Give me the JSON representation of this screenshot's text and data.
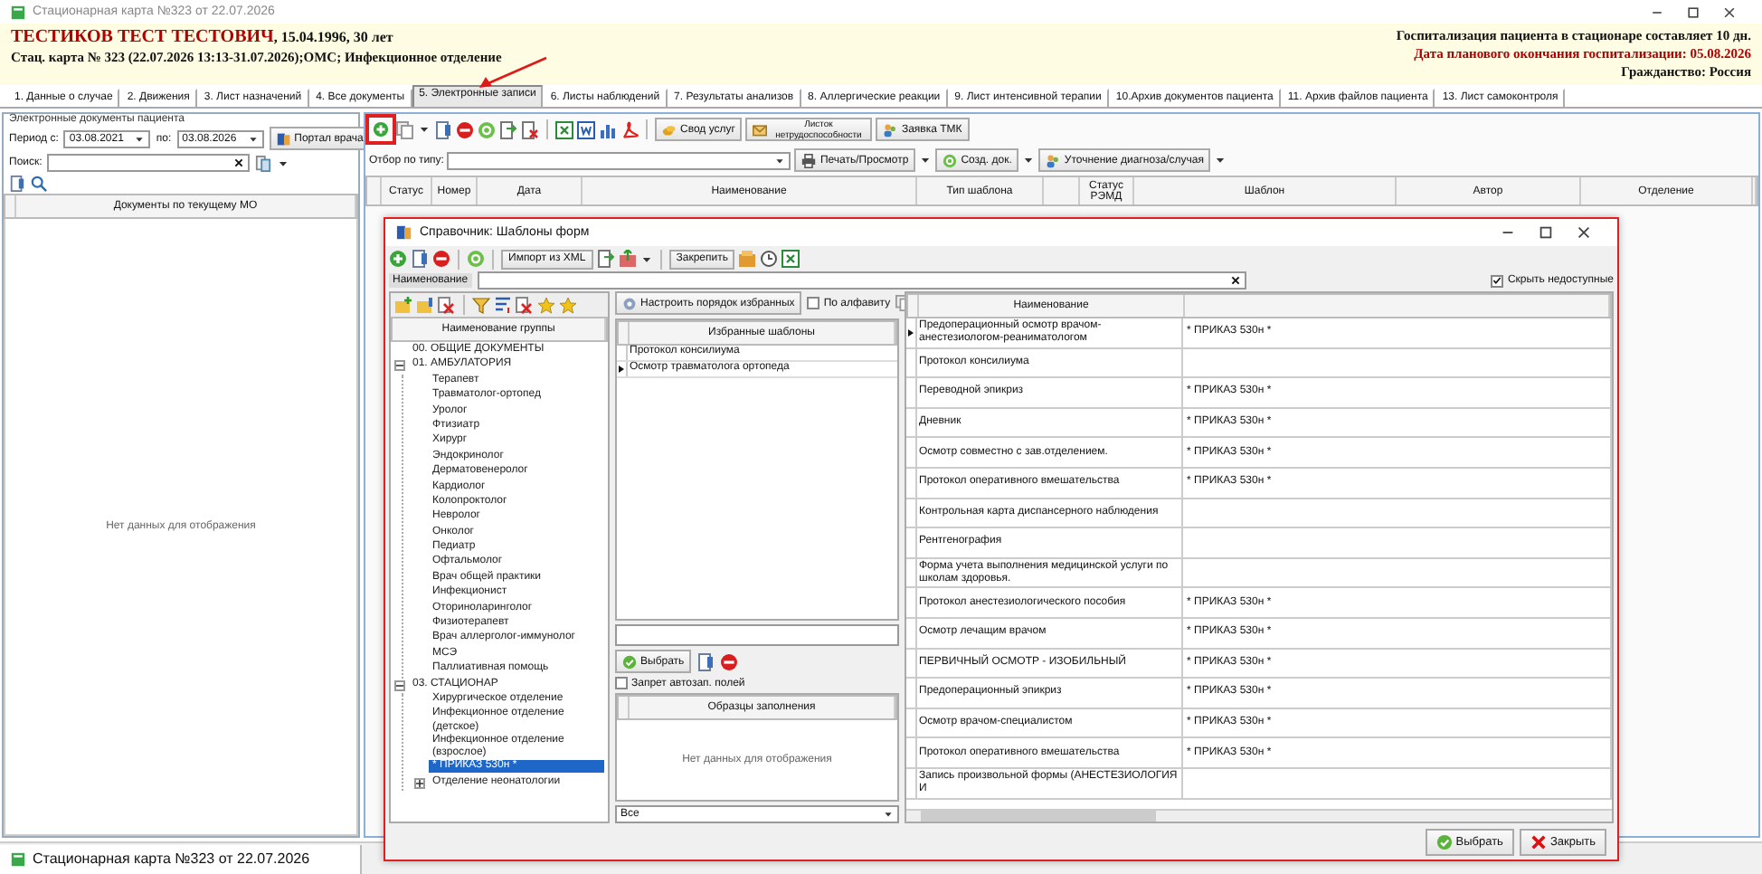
{
  "window": {
    "title": "Стационарная карта №323 от 22.07.2026"
  },
  "patient": {
    "name": "ТЕСТИКОВ ТЕСТ ТЕСТОВИЧ",
    "info": ", 15.04.1996, 30 лет",
    "card": "Стац. карта  № 323 (22.07.2026 13:13-31.07.2026);ОМС; Инфекционное отделение",
    "stay": "Госпитализация пациента в стационаре составляет 10 дн.",
    "planned_end": "Дата планового окончания госпитализации: 05.08.2026",
    "citizenship": "Гражданство: Россия"
  },
  "tabs": [
    {
      "label": "1. Данные о случае",
      "selected": false
    },
    {
      "label": "2. Движения",
      "selected": false
    },
    {
      "label": "3. Лист назначений",
      "selected": false
    },
    {
      "label": "4. Все документы",
      "selected": false
    },
    {
      "label": "5. Электронные записи",
      "selected": true
    },
    {
      "label": "6. Листы наблюдений",
      "selected": false
    },
    {
      "label": "7. Результаты анализов",
      "selected": false
    },
    {
      "label": "8. Аллергические реакции",
      "selected": false
    },
    {
      "label": "9. Лист интенсивной терапии",
      "selected": false
    },
    {
      "label": "10.Архив документов пациента",
      "selected": false
    },
    {
      "label": "11. Архив файлов пациента",
      "selected": false
    },
    {
      "label": "13. Лист самоконтроля",
      "selected": false
    }
  ],
  "left_panel": {
    "title": "Электронные документы пациента",
    "period_label": "Период с:",
    "date_from": "03.08.2021",
    "to_label": "по:",
    "date_to": "03.08.2026",
    "portal_button": "Портал врача",
    "search_label": "Поиск:",
    "column": "Документы по текущему МО",
    "empty": "Нет данных для отображения"
  },
  "toolbar": {
    "add_highlighted": true,
    "buttons": [
      "Свод услуг",
      "Листок нетрудоспособности",
      "Заявка ТМК"
    ],
    "filter_label": "Отбор по типу:",
    "print_button": "Печать/Просмотр",
    "create_button": "Созд. док.",
    "clarify_button": "Уточнение диагноза/случая"
  },
  "table": {
    "columns": [
      {
        "label": "Статус"
      },
      {
        "label": "Номер"
      },
      {
        "label": "Дата"
      },
      {
        "label": "Наименование"
      },
      {
        "label": "Тип шаблона"
      },
      {
        "kind": "blank"
      },
      {
        "label": "Статус РЭМД"
      },
      {
        "label": "Шаблон"
      },
      {
        "label": "Автор"
      },
      {
        "label": "Отделение"
      }
    ]
  },
  "dialog": {
    "title": "Справочник: Шаблоны форм",
    "import_button": "Импорт из XML",
    "pin_button": "Закрепить",
    "name_label": "Наименование",
    "hide_unavailable": {
      "label": "Скрыть недоступные",
      "checked": true
    },
    "groups": {
      "column": "Наименование группы",
      "tree": [
        {
          "label": "00. ОБЩИЕ ДОКУМЕНТЫ",
          "selected": false
        },
        {
          "label": "01. АМБУЛАТОРИЯ",
          "selected": false,
          "expanded": true,
          "children": [
            {
              "label": "Терапевт",
              "selected": false
            },
            {
              "label": "Травматолог-ортопед",
              "selected": false
            },
            {
              "label": "Уролог",
              "selected": false
            },
            {
              "label": "Фтизиатр",
              "selected": false
            },
            {
              "label": "Хирург",
              "selected": false
            },
            {
              "label": "Эндокринолог",
              "selected": false
            },
            {
              "label": "Дерматовенеролог",
              "selected": false
            },
            {
              "label": "Кардиолог",
              "selected": false
            },
            {
              "label": "Колопроктолог",
              "selected": false
            },
            {
              "label": "Невролог",
              "selected": false
            },
            {
              "label": "Онколог",
              "selected": false
            },
            {
              "label": "Педиатр",
              "selected": false
            },
            {
              "label": "Офтальмолог",
              "selected": false
            },
            {
              "label": "Врач общей практики",
              "selected": false
            },
            {
              "label": "Инфекционист",
              "selected": false
            },
            {
              "label": "Оториноларинголог",
              "selected": false
            },
            {
              "label": "Физиотерапевт",
              "selected": false
            },
            {
              "label": "Врач аллерголог-иммунолог",
              "selected": false
            },
            {
              "label": "МСЭ",
              "selected": false
            },
            {
              "label": "Паллиативная помощь",
              "selected": false
            }
          ]
        },
        {
          "label": "03. СТАЦИОНАР",
          "selected": false,
          "expanded": true,
          "children": [
            {
              "label": "Хирургическое отделение",
              "selected": false
            },
            {
              "label": "Инфекционное отделение (детское)",
              "selected": false
            },
            {
              "label": "Инфекционное отделение (взрослое)",
              "selected": false
            },
            {
              "label": "* ПРИКАЗ 530н *",
              "selected": true
            },
            {
              "label": "Отделение неонатологии",
              "selected": false,
              "expanded": false
            }
          ]
        }
      ]
    },
    "favorites": {
      "sort_button": "Настроить порядок избранных",
      "alphabet": {
        "label": "По алфавиту",
        "checked": false
      },
      "column": "Избранные шаблоны",
      "rows": [
        {
          "label": "Протокол консилиума",
          "selected": false
        },
        {
          "label": "Осмотр травматолога ортопеда",
          "selected": true
        }
      ]
    },
    "samples": {
      "select_button": "Выбрать",
      "no_autofill": {
        "label": "Запрет автозап. полей",
        "checked": false
      },
      "column": "Образцы заполнения",
      "empty": "Нет данных для отображения",
      "filter": "Все"
    },
    "templates": {
      "column": "Наименование",
      "rows": [
        {
          "name": "Предоперационный осмотр врачом-анестезиологом-реаниматологом",
          "group": "* ПРИКАЗ 530н *",
          "selected": true
        },
        {
          "name": "Протокол консилиума",
          "selected": false
        },
        {
          "name": "Переводной эпикриз",
          "group": "* ПРИКАЗ 530н *",
          "selected": false
        },
        {
          "name": "Дневник",
          "group": "* ПРИКАЗ 530н *",
          "selected": false
        },
        {
          "name": "Осмотр совместно с зав.отделением.",
          "group": "* ПРИКАЗ 530н *",
          "selected": false
        },
        {
          "name": "Протокол оперативного вмешательства",
          "group": "* ПРИКАЗ 530н *",
          "selected": false
        },
        {
          "name": "Контрольная карта диспансерного наблюдения",
          "selected": false
        },
        {
          "name": "Рентгенография",
          "selected": false
        },
        {
          "name": "Форма учета выполнения медицинской услуги по школам здоровья.",
          "selected": false
        },
        {
          "name": "Протокол анестезиологического пособия",
          "group": "* ПРИКАЗ 530н *",
          "selected": false
        },
        {
          "name": "Осмотр лечащим врачом",
          "group": "* ПРИКАЗ 530н *",
          "selected": false
        },
        {
          "name": "ПЕРВИЧНЫЙ ОСМОТР - ИЗОБИЛЬНЫЙ",
          "group": "* ПРИКАЗ 530н *",
          "selected": false
        },
        {
          "name": "Предоперационный эпикриз",
          "group": "* ПРИКАЗ 530н *",
          "selected": false
        },
        {
          "name": "Осмотр врачом-специалистом",
          "group": "* ПРИКАЗ 530н *",
          "selected": false
        },
        {
          "name": "Протокол оперативного вмешательства",
          "group": "* ПРИКАЗ 530н *",
          "selected": false
        },
        {
          "name": "Запись произвольной формы (АНЕСТЕЗИОЛОГИЯ И",
          "selected": false
        }
      ]
    },
    "buttons": [
      "Выбрать",
      "Закрыть"
    ]
  },
  "taskbar": {
    "item": "Стационарная карта №323 от 22.07.2026"
  }
}
